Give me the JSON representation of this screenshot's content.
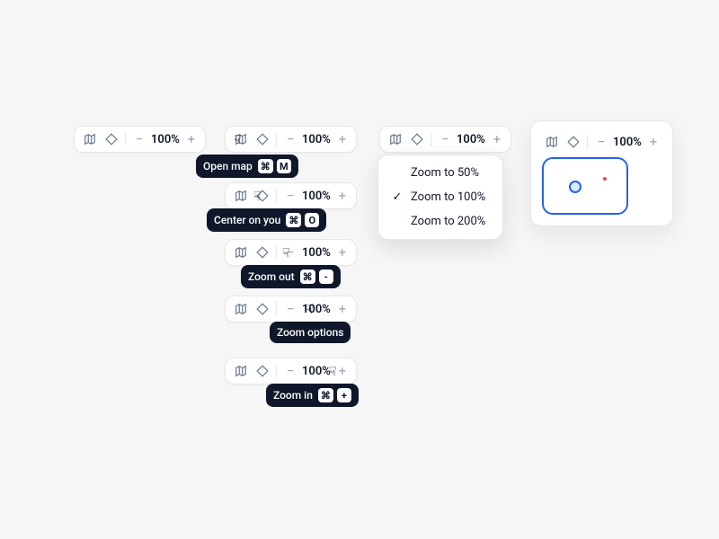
{
  "zoom_label": "100%",
  "tooltips": {
    "open_map": {
      "label": "Open map",
      "keys": [
        "⌘",
        "M"
      ]
    },
    "center": {
      "label": "Center on you",
      "keys": [
        "⌘",
        "O"
      ]
    },
    "zoom_out": {
      "label": "Zoom out",
      "keys": [
        "⌘",
        "-"
      ]
    },
    "zoom_opts": {
      "label": "Zoom options",
      "keys": []
    },
    "zoom_in": {
      "label": "Zoom in",
      "keys": [
        "⌘",
        "+"
      ]
    }
  },
  "dropdown": {
    "items": [
      {
        "label": "Zoom to 50%",
        "checked": false
      },
      {
        "label": "Zoom to 100%",
        "checked": true
      },
      {
        "label": "Zoom to 200%",
        "checked": false
      }
    ]
  },
  "icons": {
    "map": "map-icon",
    "locate": "locate-icon",
    "minus": "−",
    "plus": "+",
    "check": "✓",
    "cursor_text": "☟"
  }
}
